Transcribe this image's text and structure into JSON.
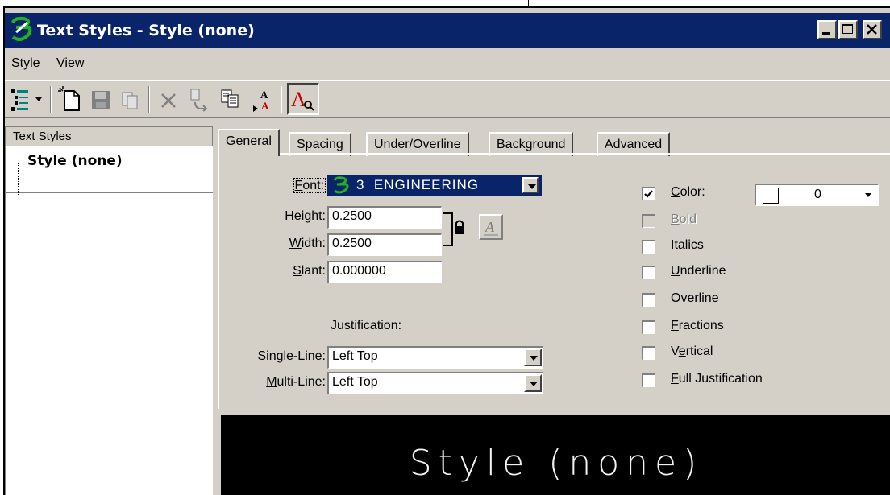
{
  "window": {
    "title": "Text Styles - Style (none)"
  },
  "menu": {
    "items": [
      {
        "accel": "S",
        "rest": "tyle"
      },
      {
        "accel": "V",
        "rest": "iew"
      }
    ]
  },
  "toolbar": {
    "icons": [
      "tree-view-icon",
      "new-style-icon",
      "save-icon",
      "copy-icon",
      "delete-icon",
      "reset-icon",
      "import-icon",
      "select-icon",
      "text-style-icon"
    ]
  },
  "left_panel": {
    "header": "Text Styles",
    "tree_items": [
      "Style (none)"
    ]
  },
  "tabs": [
    "General",
    "Spacing",
    "Under/Overline",
    "Background",
    "Advanced"
  ],
  "general": {
    "font": {
      "accel": "F",
      "rest": "ont:",
      "number": "3",
      "name": "ENGINEERING"
    },
    "height": {
      "accel": "H",
      "rest": "eight:",
      "value": "0.2500"
    },
    "width": {
      "accel": "W",
      "rest": "idth:",
      "value": "0.2500"
    },
    "slant": {
      "accel": "S",
      "rest": "lant:",
      "value": "0.000000"
    },
    "justification_label": "Justification:",
    "single_line": {
      "accel": "S",
      "rest": "ingle-Line:",
      "value": "Left Top"
    },
    "multi_line": {
      "accel": "M",
      "rest": "ulti-Line:",
      "value": "Left Top"
    },
    "options": [
      {
        "accel": "C",
        "rest": "olor:",
        "checked": true,
        "disabled": false
      },
      {
        "accel": "B",
        "rest": "old",
        "checked": false,
        "disabled": true
      },
      {
        "accel": "I",
        "rest": "talics",
        "checked": false,
        "disabled": false
      },
      {
        "accel": "U",
        "rest": "nderline",
        "checked": false,
        "disabled": false
      },
      {
        "accel": "O",
        "rest": "verline",
        "checked": false,
        "disabled": false
      },
      {
        "accel": "F",
        "rest": "ractions",
        "checked": false,
        "disabled": false
      },
      {
        "accel": "e",
        "pre": "V",
        "rest": "rtical",
        "checked": false,
        "disabled": false
      },
      {
        "accel": "F",
        "rest": "ull Justification",
        "checked": false,
        "disabled": false
      }
    ],
    "color_value": "0",
    "color_swatch": "#ffffff"
  },
  "preview": {
    "text": "Style (none)"
  },
  "colors": {
    "titlebar": "#0a246a",
    "face": "#d4d0c8",
    "preview_bg": "#000000"
  }
}
